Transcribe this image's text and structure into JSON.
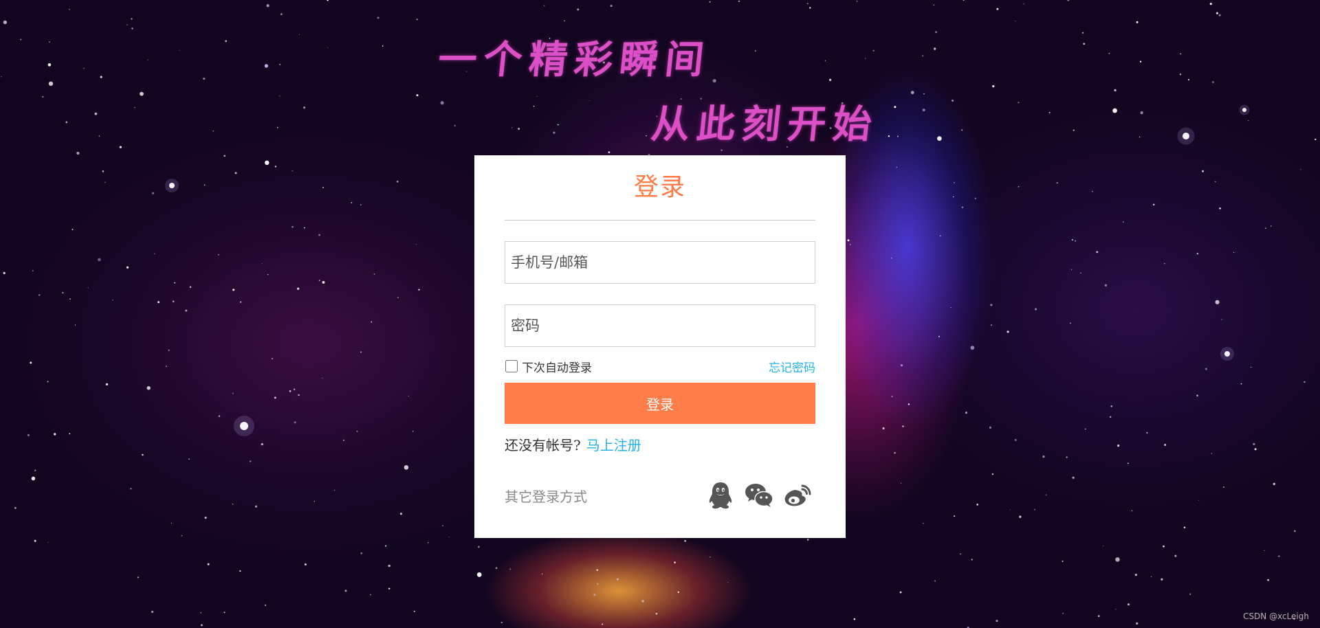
{
  "background": {
    "headline_line1": "一个精彩瞬间",
    "headline_line2": "从此刻开始"
  },
  "login": {
    "title": "登录",
    "account_placeholder": "手机号/邮箱",
    "password_placeholder": "密码",
    "remember_label": "下次自动登录",
    "remember_checked": false,
    "forgot_label": "忘记密码",
    "submit_label": "登录",
    "register_prompt": "还没有帐号?",
    "register_link": "马上注册",
    "other_methods_label": "其它登录方式",
    "social_icons": [
      "qq-icon",
      "wechat-icon",
      "weibo-icon"
    ]
  },
  "watermark": "CSDN @xcLeigh",
  "colors": {
    "accent": "#ff7d48",
    "link": "#22b2e6",
    "headline": "#dd4fc6",
    "icon": "#555555"
  }
}
